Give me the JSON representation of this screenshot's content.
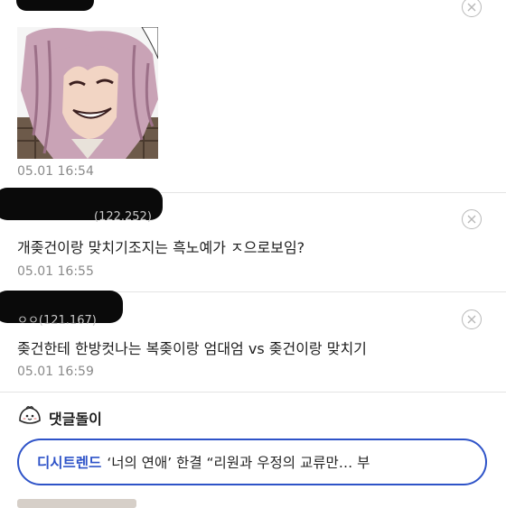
{
  "comments": [
    {
      "time": "05.01 16:54",
      "has_image": true
    },
    {
      "user_suffix": "(122.252)",
      "text": "개좆건이랑 맞치기조지는 흑노예가 ㅈ으로보임?",
      "time": "05.01 16:55"
    },
    {
      "user_suffix": "ㅇㅇ(121.167)",
      "text": "좆건한테 한방컷나는 복좆이랑 엄대엄 vs 좆건이랑 맞치기",
      "time": "05.01 16:59"
    }
  ],
  "section": {
    "title": "댓글돌이",
    "icon": "dumpling-mascot-icon"
  },
  "trend": {
    "tag": "디시트렌드",
    "headline": "‘너의 연애’ 한결 “리원과 우정의 교류만… 부"
  },
  "icons": {
    "close": "close-circle-icon"
  },
  "colors": {
    "accent": "#2e53c8",
    "divider": "#e3e3e3",
    "timestamp": "#8a8a8a"
  }
}
